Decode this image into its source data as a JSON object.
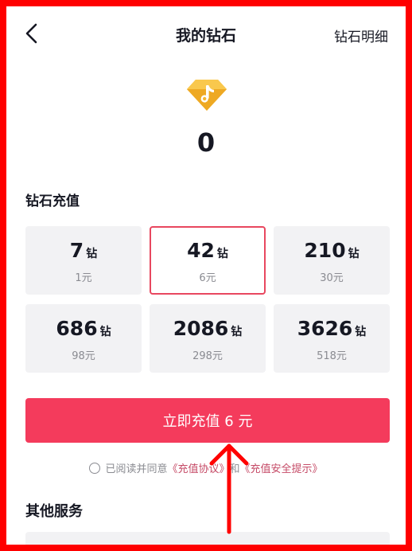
{
  "header": {
    "title": "我的钻石",
    "detail_label": "钻石明细"
  },
  "balance": {
    "value": "0"
  },
  "recharge": {
    "section_title": "钻石充值",
    "unit": "钻",
    "packages": [
      {
        "amount": "7",
        "price": "1元",
        "selected": false
      },
      {
        "amount": "42",
        "price": "6元",
        "selected": true
      },
      {
        "amount": "210",
        "price": "30元",
        "selected": false
      },
      {
        "amount": "686",
        "price": "98元",
        "selected": false
      },
      {
        "amount": "2086",
        "price": "298元",
        "selected": false
      },
      {
        "amount": "3626",
        "price": "518元",
        "selected": false
      }
    ]
  },
  "pay_button": {
    "label": "立即充值 6 元"
  },
  "agreement": {
    "prefix": "已阅读并同意",
    "link1": "《充值协议》",
    "joiner": "和",
    "link2": "《充值安全提示》"
  },
  "other": {
    "section_title": "其他服务"
  },
  "colors": {
    "accent": "#f43b5c",
    "selected_border": "#e8475f",
    "link": "#c54a66",
    "diamond": "#f5b731",
    "annotation": "#ff0000"
  },
  "icons": {
    "back": "chevron-left-icon",
    "diamond": "diamond-icon",
    "radio": "radio-unchecked-icon"
  }
}
